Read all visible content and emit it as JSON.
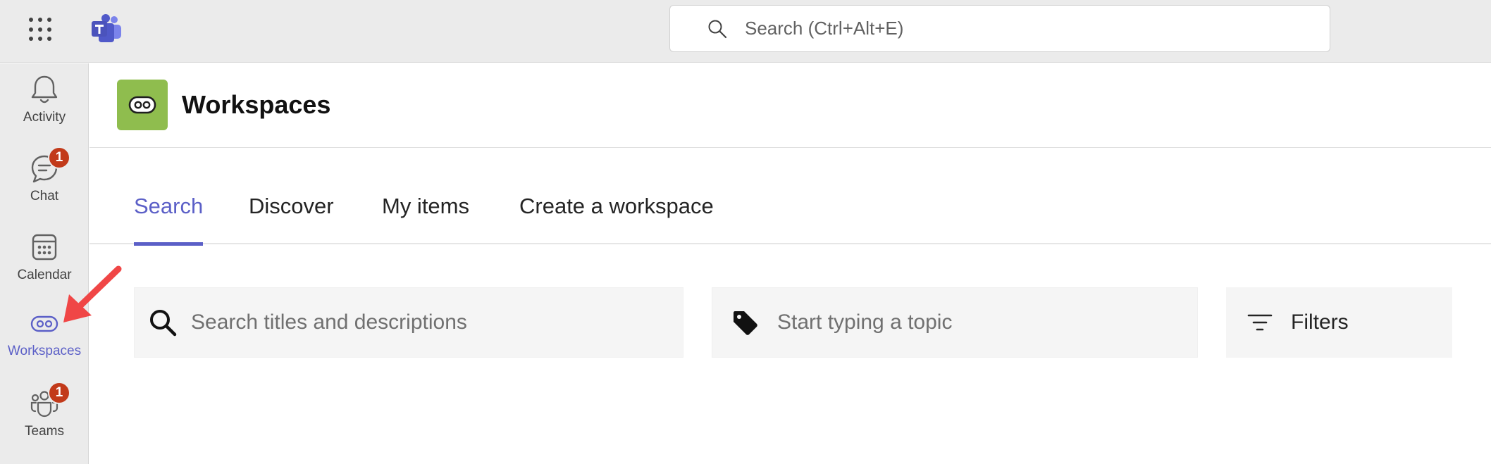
{
  "topbar": {
    "search_placeholder": "Search (Ctrl+Alt+E)",
    "icons": [
      "app-launcher-icon",
      "teams-logo-icon",
      "search-icon"
    ]
  },
  "rail": {
    "items": [
      {
        "label": "Activity",
        "icon": "bell-icon",
        "badge": null,
        "active": false
      },
      {
        "label": "Chat",
        "icon": "chat-icon",
        "badge": "1",
        "active": false
      },
      {
        "label": "Calendar",
        "icon": "calendar-icon",
        "badge": null,
        "active": false
      },
      {
        "label": "Workspaces",
        "icon": "workspaces-icon",
        "badge": null,
        "active": true
      },
      {
        "label": "Teams",
        "icon": "teams-icon",
        "badge": "1",
        "active": false
      }
    ]
  },
  "app": {
    "title": "Workspaces",
    "logo_icon": "workspaces-icon"
  },
  "tabs": [
    {
      "label": "Search",
      "active": true
    },
    {
      "label": "Discover",
      "active": false
    },
    {
      "label": "My items",
      "active": false
    },
    {
      "label": "Create a workspace",
      "active": false
    }
  ],
  "search": {
    "titles_placeholder": "Search titles and descriptions",
    "topic_placeholder": "Start typing a topic",
    "filters_label": "Filters"
  },
  "colors": {
    "accent": "#5b5fc7",
    "badge": "#c23a1a",
    "app_logo_bg": "#8fbd4e",
    "annotation_arrow": "#f04646"
  }
}
